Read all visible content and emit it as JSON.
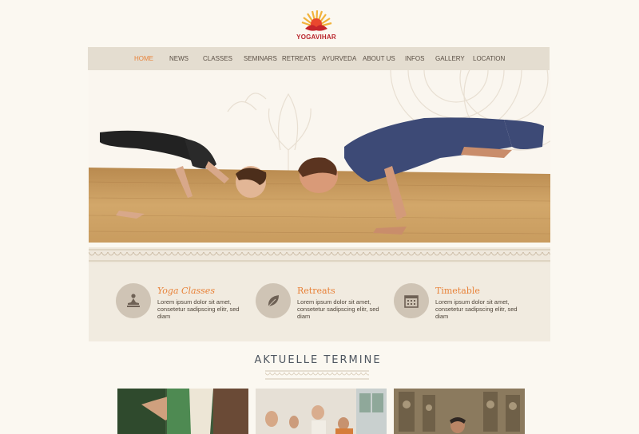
{
  "logo": {
    "text": "YOGAVIHAR"
  },
  "nav": {
    "items": [
      {
        "label": "HOME",
        "active": true
      },
      {
        "label": "NEWS"
      },
      {
        "label": "CLASSES"
      },
      {
        "label": "SEMINARS"
      },
      {
        "label": "RETREATS"
      },
      {
        "label": "AYURVEDA"
      },
      {
        "label": "ABOUT US"
      },
      {
        "label": "INFOS"
      },
      {
        "label": "GALLERY"
      },
      {
        "label": "LOCATION"
      }
    ]
  },
  "features": [
    {
      "title": "Yoga Classes",
      "icon": "meditation-icon",
      "text_line1": "Lorem ipsum dolor sit amet,",
      "text_line2": "consetetur sadipscing elitr, sed diam"
    },
    {
      "title": "Retreats",
      "icon": "leaf-icon",
      "text_line1": "Lorem ipsum dolor sit amet,",
      "text_line2": "consetetur sadipscing elitr, sed diam"
    },
    {
      "title": "Timetable",
      "icon": "calendar-icon",
      "text_line1": "Lorem ipsum dolor sit amet,",
      "text_line2": "consetetur sadipscing elitr, sed diam"
    }
  ],
  "section": {
    "title": "AKTUELLE TERMINE"
  },
  "colors": {
    "accent": "#e8833a",
    "nav_bg": "#e4ddd0",
    "feature_bg": "#f1ebe0",
    "logo_red": "#b8232a"
  }
}
